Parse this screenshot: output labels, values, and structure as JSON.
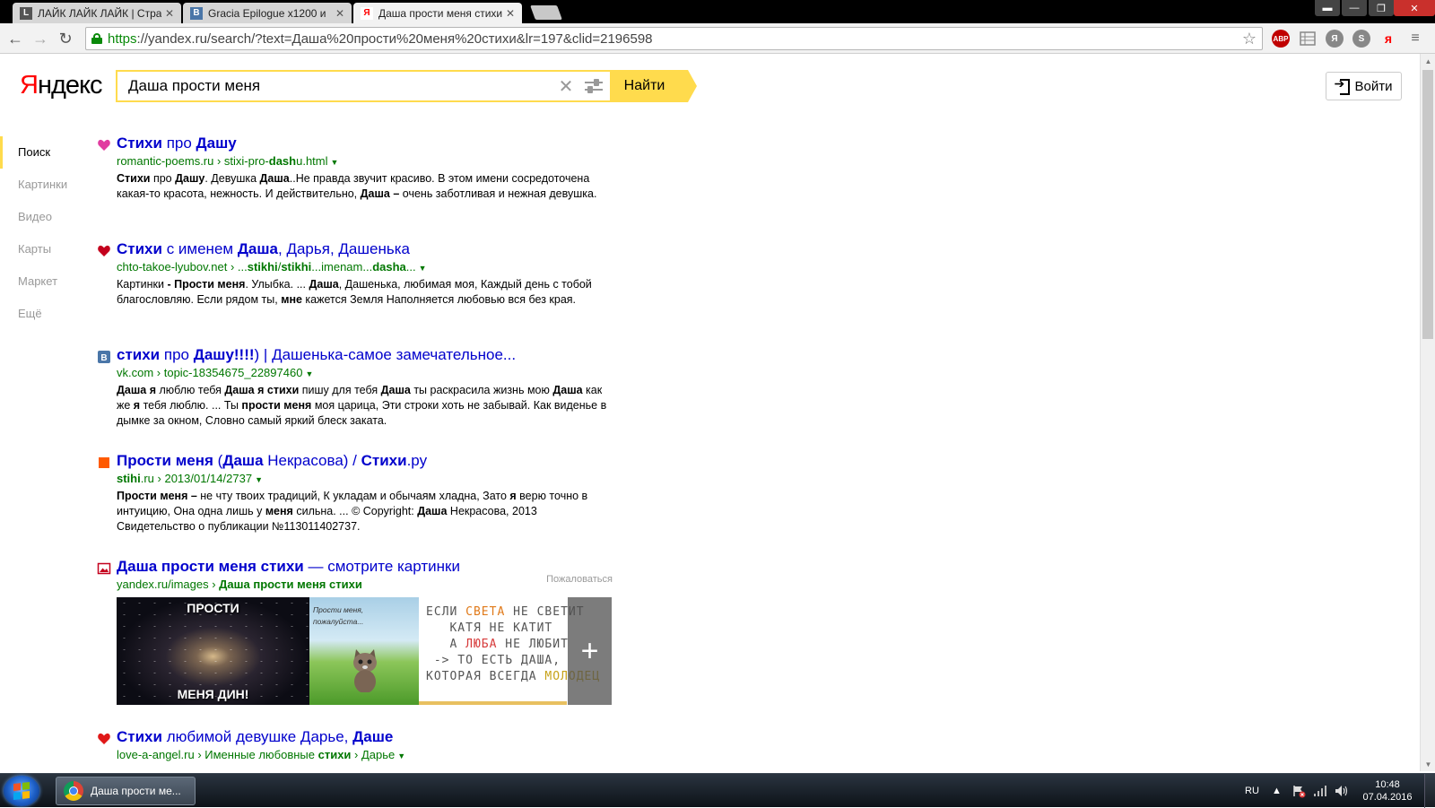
{
  "browser": {
    "tabs": [
      {
        "title": "ЛАЙК ЛАЙК ЛАЙК | Стра",
        "favicon_letter": "L",
        "favicon_color": "#555555"
      },
      {
        "title": "Gracia Epilogue x1200 и",
        "favicon_letter": "В",
        "favicon_color": "#4a76a8"
      },
      {
        "title": "Даша прости меня стихи",
        "favicon_letter": "Я",
        "favicon_color": "#ff0000"
      }
    ],
    "url_proto": "https",
    "url_rest": "://yandex.ru/search/?text=Даша%20прости%20меня%20стихи&lr=197&clid=2196598",
    "extensions": [
      {
        "label": "ABP",
        "color": "#c00000"
      },
      {
        "label": "Я",
        "color": "#888888"
      },
      {
        "label": "S",
        "color": "#888888"
      },
      {
        "label": "я",
        "color": "#ff0000"
      }
    ]
  },
  "header": {
    "logo_first": "Я",
    "logo_rest": "ндекс",
    "search_value": "Даша прости меня",
    "search_button": "Найти",
    "login_button": "Войти"
  },
  "nav": {
    "items": [
      "Поиск",
      "Картинки",
      "Видео",
      "Карты",
      "Маркет",
      "Ещё"
    ]
  },
  "results": [
    {
      "favicon": "heart-pink-icon",
      "title_html": "<b>Стихи</b> про <b>Дашу</b>",
      "url_html": "romantic-poems.ru › stixi-pro-<b>dash</b>u.html",
      "snippet_html": "<b>Стихи</b> про <b>Дашу</b>. Девушка <b>Даша</b>..Не правда звучит красиво. В этом имени сосредоточена какая-то красота, нежность. И действительно, <b>Даша –</b> очень заботливая и нежная девушка."
    },
    {
      "favicon": "heart-red-icon",
      "title_html": "<b>Стихи</b> с именем <b>Даша</b>, Дарья, Дашенька",
      "url_html": "chto-takoe-lyubov.net › ...<b>stikhi</b>/<b>stikhi</b>...imenam...<b>dasha</b>...",
      "snippet_html": "Картинки <b>- Прости меня</b>. Улыбка. ... <b>Даша</b>, Дашенька, любимая моя, Каждый день с тобой благословляю. Если рядом ты, <b>мне</b> кажется Земля Наполняется любовью вся без края."
    },
    {
      "favicon": "vk-icon",
      "title_html": "<b>стихи</b> про <b>Дашу!!!!</b>) | Дашенька-самое замечательное...",
      "url_html": "vk.com › topic-18354675_22897460",
      "snippet_html": "<b>Даша я</b> люблю тебя <b>Даша я стихи</b> пишу для тебя <b>Даша</b> ты раскрасила жизнь мою <b>Даша</b> как же <b>я</b> тебя люблю. ... Ты <b>прости меня</b> моя царица, Эти строки хоть не забывай. Как виденье в дымке за окном, Словно самый яркий блеск заката."
    },
    {
      "favicon": "orange-square-icon",
      "title_html": "<b>Прости меня</b> (<b>Даша</b> Некрасова) / <b>Стихи</b>.ру",
      "url_html": "<b>stihi</b>.ru › 2013/01/14/2737",
      "snippet_html": "<b>Прости меня –</b> не чту твоих традиций, К укладам и обычаям хладна, Зато <b>я</b> верю точно в интуицию, Она одна лишь у <b>меня</b> сильна. ... © Copyright: <b>Даша</b> Некрасова, 2013 Свидетельство о публикации №113011402737."
    }
  ],
  "images_block": {
    "title_html": "<b>Даша прости меня стихи</b> — смотрите картинки",
    "url_html": "yandex.ru/images › <b>Даша прости меня стихи</b>",
    "complain": "Пожаловаться",
    "img1_top": "ПРОСТИ",
    "img1_bottom": "МЕНЯ ДИН!",
    "img2_caption": "Прости меня,\nпожалуйста...",
    "img3_lines": [
      [
        "ЕСЛИ ",
        "СВЕТА",
        " НЕ СВЕТИТ"
      ],
      [
        "   КАТЯ НЕ КАТИТ"
      ],
      [
        "   А ",
        "ЛЮБА",
        " НЕ ЛЮБИТ"
      ],
      [
        " -> ТО ЕСТЬ ДАША,"
      ],
      [
        "КОТОРАЯ ВСЕГДА ",
        "МОЛОДЕЦ"
      ]
    ],
    "more_symbol": "+"
  },
  "last_result": {
    "favicon": "heart-red-icon",
    "title_html": "<b>Стихи</b> любимой девушке Дарье, <b>Даше</b>",
    "url_html": "love-a-angel.ru › Именные любовные <b>стихи</b> › Дарье"
  },
  "taskbar": {
    "app_title": "Даша прости ме...",
    "lang": "RU",
    "time": "10:48",
    "date": "07.04.2016"
  }
}
